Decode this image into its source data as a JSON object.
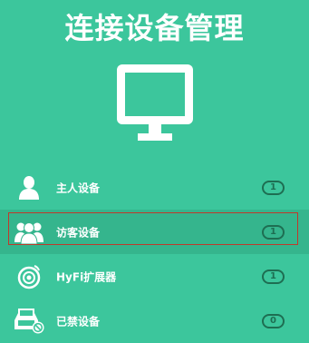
{
  "header": {
    "title": "连接设备管理"
  },
  "colors": {
    "background": "#3cc69c",
    "selected_row": "#35b58d",
    "badge": "#1e6e52",
    "selection_outline": "#c0392b"
  },
  "devices": [
    {
      "label": "主人设备",
      "count": "1",
      "icon": "user-icon"
    },
    {
      "label": "访客设备",
      "count": "1",
      "icon": "guests-icon",
      "selected": true
    },
    {
      "label": "HyFi扩展器",
      "count": "1",
      "icon": "extender-icon"
    },
    {
      "label": "已禁设备",
      "count": "0",
      "icon": "blocked-devices-icon"
    }
  ]
}
